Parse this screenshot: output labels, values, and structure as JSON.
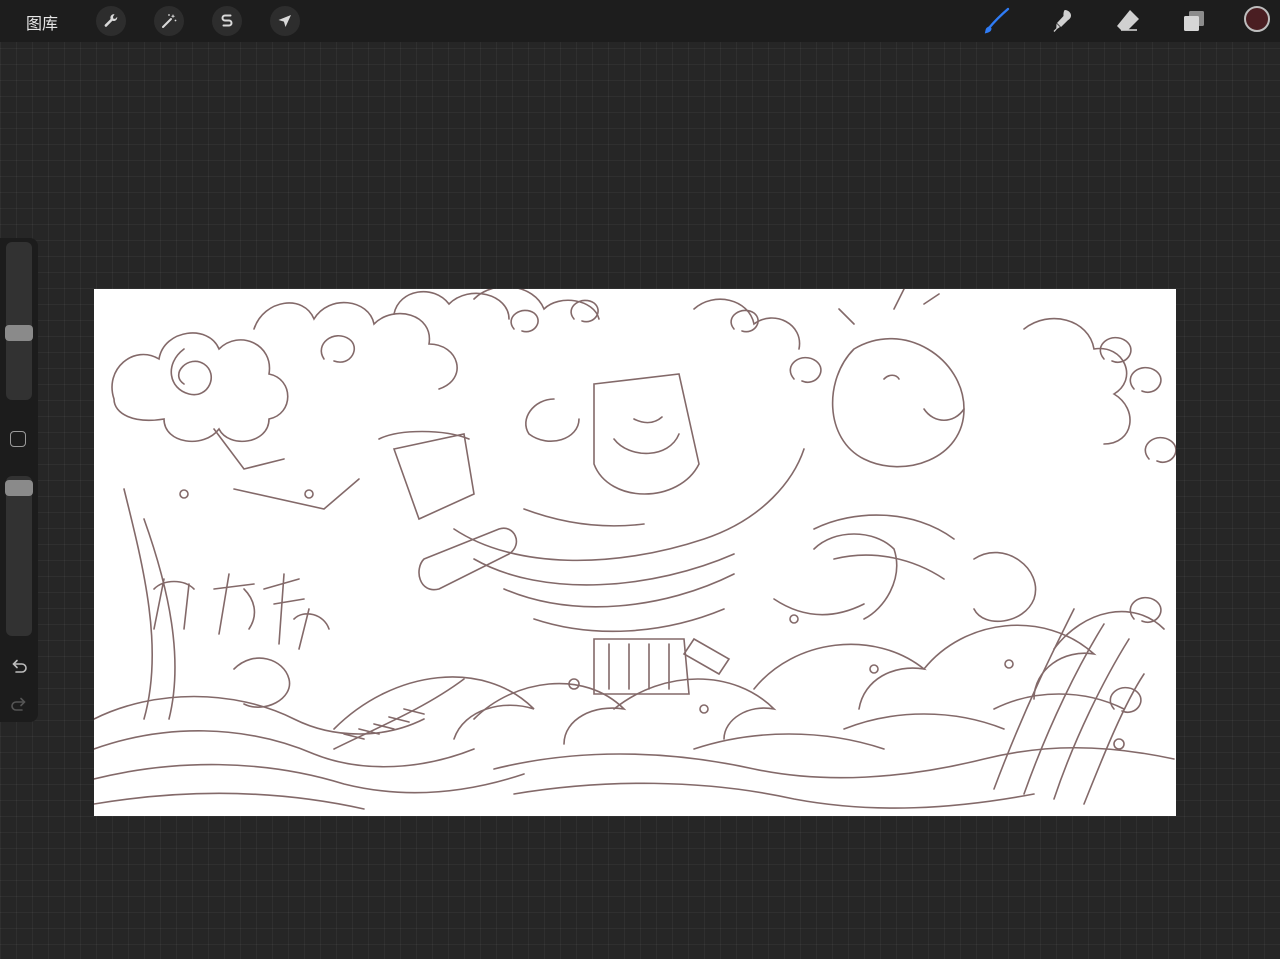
{
  "toolbar": {
    "gallery_label": "图库",
    "left_tools": [
      {
        "name": "actions",
        "icon": "wrench-icon"
      },
      {
        "name": "adjustments",
        "icon": "magic-wand-icon"
      },
      {
        "name": "selection",
        "icon": "selection-s-icon"
      },
      {
        "name": "transform",
        "icon": "arrow-cursor-icon"
      }
    ],
    "right_tools": [
      {
        "name": "brush",
        "icon": "brush-icon",
        "active": true,
        "color": "#2f7cf6"
      },
      {
        "name": "smudge",
        "icon": "smudge-icon",
        "active": false
      },
      {
        "name": "eraser",
        "icon": "eraser-icon",
        "active": false
      },
      {
        "name": "layers",
        "icon": "layers-icon",
        "active": false
      }
    ],
    "current_color": "#4a1e22"
  },
  "sidebar": {
    "brush_size_level": 0.58,
    "opacity_level": 0.92,
    "undo_icon": "undo-icon",
    "redo_icon": "redo-icon"
  },
  "canvas": {
    "background": "#ffffff",
    "ink_color": "#4a2a2a",
    "content": "sketch-artwork"
  }
}
